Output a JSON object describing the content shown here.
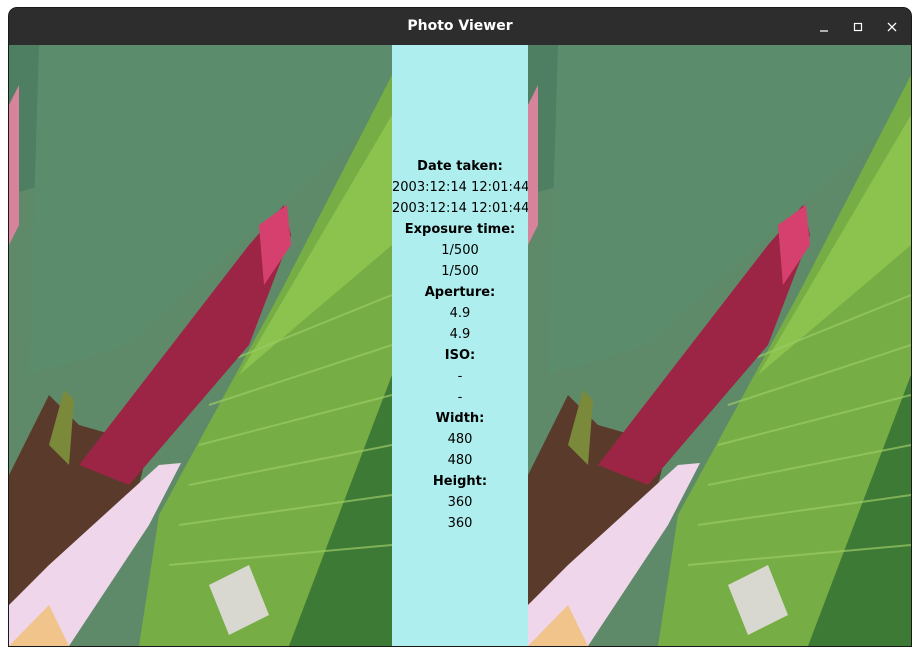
{
  "window": {
    "title": "Photo Viewer",
    "controls": {
      "minimize": "minimize-icon",
      "maximize": "maximize-icon",
      "close": "close-icon"
    }
  },
  "info": {
    "date_label": "Date taken:",
    "date_value_1": "2003:12:14 12:01:44",
    "date_value_2": "2003:12:14 12:01:44",
    "exposure_label": "Exposure time:",
    "exposure_value_1": "1/500",
    "exposure_value_2": "1/500",
    "aperture_label": "Aperture:",
    "aperture_value_1": "4.9",
    "aperture_value_2": "4.9",
    "iso_label": "ISO:",
    "iso_value_1": "-",
    "iso_value_2": "-",
    "width_label": "Width:",
    "width_value_1": "480",
    "width_value_2": "480",
    "height_label": "Height:",
    "height_value_1": "360",
    "height_value_2": "360"
  },
  "colors": {
    "titlebar": "#2d2d2d",
    "info_panel": "#afeeee",
    "leaf_green": "#6fa83a",
    "bud_pink": "#c8306a"
  }
}
